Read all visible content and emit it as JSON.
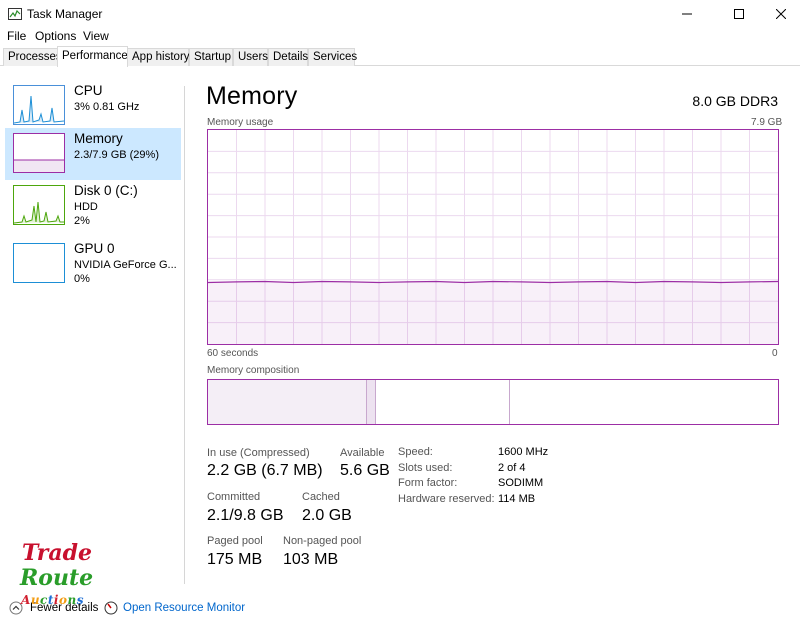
{
  "window": {
    "title": "Task Manager"
  },
  "menu": [
    "File",
    "Options",
    "View"
  ],
  "tabs": [
    {
      "label": "Processes",
      "active": false
    },
    {
      "label": "Performance",
      "active": true
    },
    {
      "label": "App history",
      "active": false
    },
    {
      "label": "Startup",
      "active": false
    },
    {
      "label": "Users",
      "active": false
    },
    {
      "label": "Details",
      "active": false
    },
    {
      "label": "Services",
      "active": false
    }
  ],
  "sidebar": {
    "items": [
      {
        "title": "CPU",
        "line1": "3% 0.81 GHz",
        "line2": ""
      },
      {
        "title": "Memory",
        "line1": "2.3/7.9 GB (29%)",
        "line2": ""
      },
      {
        "title": "Disk 0 (C:)",
        "line1": "HDD",
        "line2": "2%"
      },
      {
        "title": "GPU 0",
        "line1": "NVIDIA GeForce G...",
        "line2": "0%"
      }
    ]
  },
  "memory": {
    "title": "Memory",
    "spec": "8.0 GB DDR3",
    "usage_label": "Memory usage",
    "usage_max": "7.9 GB",
    "time_left": "60 seconds",
    "time_right": "0",
    "composition_label": "Memory composition",
    "usage_level": 0.29
  },
  "stats": {
    "in_use_label": "In use (Compressed)",
    "in_use_value": "2.2 GB (6.7 MB)",
    "available_label": "Available",
    "available_value": "5.6 GB",
    "committed_label": "Committed",
    "committed_value": "2.1/9.8 GB",
    "cached_label": "Cached",
    "cached_value": "2.0 GB",
    "paged_label": "Paged pool",
    "paged_value": "175 MB",
    "nonpaged_label": "Non-paged pool",
    "nonpaged_value": "103 MB"
  },
  "hardware": {
    "speed_label": "Speed:",
    "speed_value": "1600 MHz",
    "slots_label": "Slots used:",
    "slots_value": "2 of 4",
    "form_label": "Form factor:",
    "form_value": "SODIMM",
    "reserved_label": "Hardware reserved:",
    "reserved_value": "114 MB"
  },
  "footer": {
    "fewer_details": "Fewer details",
    "open_monitor": "Open Resource Monitor"
  },
  "logo": {
    "line1": "Trade",
    "line2": "Route",
    "line3": "Auctions"
  },
  "colors": {
    "memory_accent": "#9c2ea5",
    "cpu_accent": "#1d8fd6",
    "disk_accent": "#4da60c",
    "link": "#0066cc",
    "selected": "#cce8ff"
  }
}
